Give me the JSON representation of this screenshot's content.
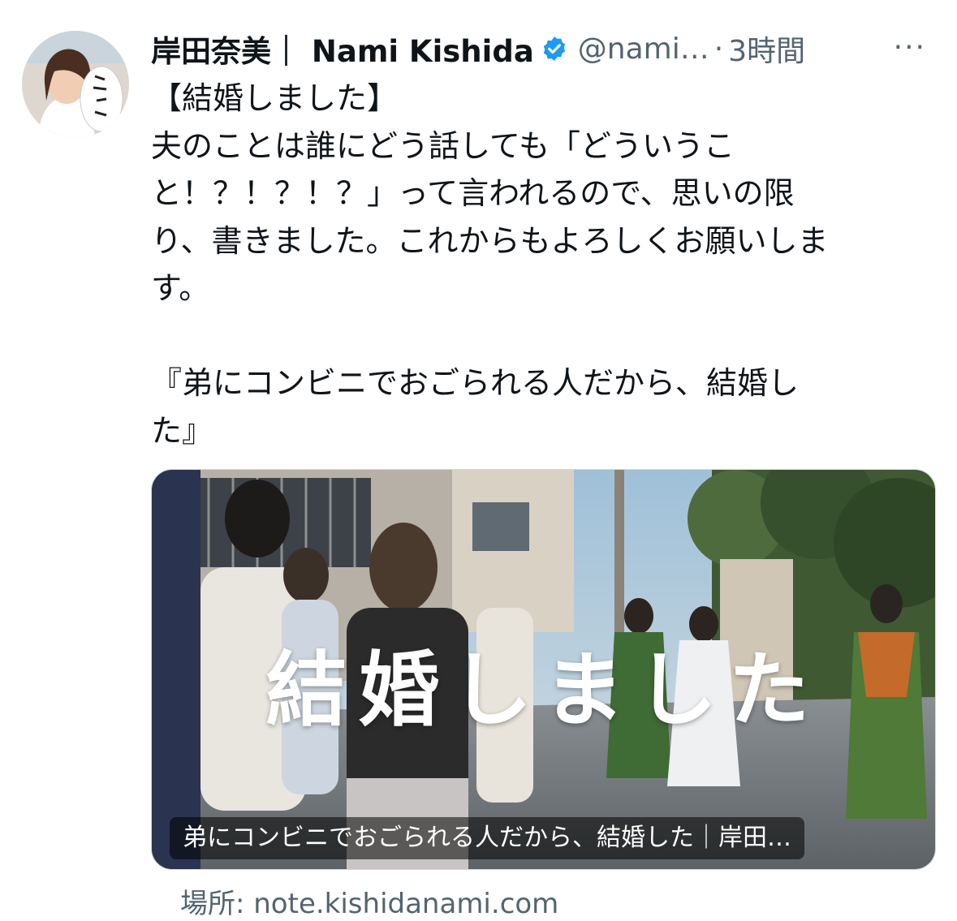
{
  "tweet": {
    "display_name": "岸田奈美｜ Nami Kishida",
    "handle": "@nami…",
    "separator": "·",
    "time": "3時間",
    "more": "···",
    "body_lines": [
      "【結婚しました】",
      "夫のことは誰にどう話しても「どういうこ",
      "と！？！？！？」って言われるので、思いの限",
      "り、書きました。これからもよろしくお願いしま",
      "す。",
      "",
      "『弟にコンビニでおごられる人だから、結婚し",
      "た』"
    ]
  },
  "card": {
    "overlay_text": "結婚しました",
    "caption": "弟にコンビニでおごられる人だから、結婚した｜岸田…",
    "source_label": "場所: note.kishidanami.com"
  },
  "icons": {
    "verified": "verified-badge-icon",
    "more": "more-icon"
  },
  "colors": {
    "verified": "#1d9bf0",
    "secondary_text": "#536471",
    "primary_text": "#0f1419"
  }
}
